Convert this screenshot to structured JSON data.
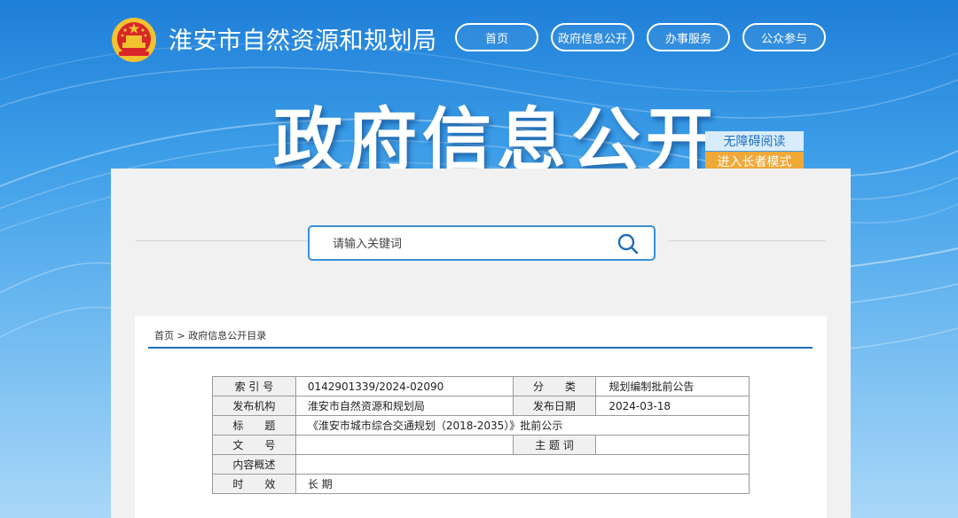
{
  "site": {
    "title": "淮安市自然资源和规划局",
    "emblem": "national-emblem"
  },
  "nav": {
    "items": [
      "首页",
      "政府信息公开",
      "办事服务",
      "公众参与"
    ]
  },
  "banner": {
    "title": "政府信息公开"
  },
  "accessibility": {
    "read_label": "无障碍阅读",
    "elder_label": "进入长者模式"
  },
  "search": {
    "placeholder": "请输入关键词",
    "icon": "search-icon"
  },
  "breadcrumb": {
    "home": "首页",
    "separator": ">",
    "current": "政府信息公开目录"
  },
  "meta_table": {
    "index_label": "索 引 号",
    "index_value": "0142901339/2024-02090",
    "category_label": "分　　类",
    "category_value": "规划编制批前公告",
    "publisher_label": "发布机构",
    "publisher_value": "淮安市自然资源和规划局",
    "date_label": "发布日期",
    "date_value": "2024-03-18",
    "title_label": "标　　题",
    "title_value": "《淮安市城市综合交通规划（2018-2035）》批前公示",
    "doc_no_label": "文　　号",
    "doc_no_value": "",
    "subject_label": "主 题 词",
    "subject_value": "",
    "summary_label": "内容概述",
    "summary_value": "",
    "validity_label": "时　　效",
    "validity_value": "长 期"
  },
  "colors": {
    "accent_blue": "#1f6fb6",
    "elder_orange": "#f0a838",
    "search_border": "#3a8fd6"
  }
}
